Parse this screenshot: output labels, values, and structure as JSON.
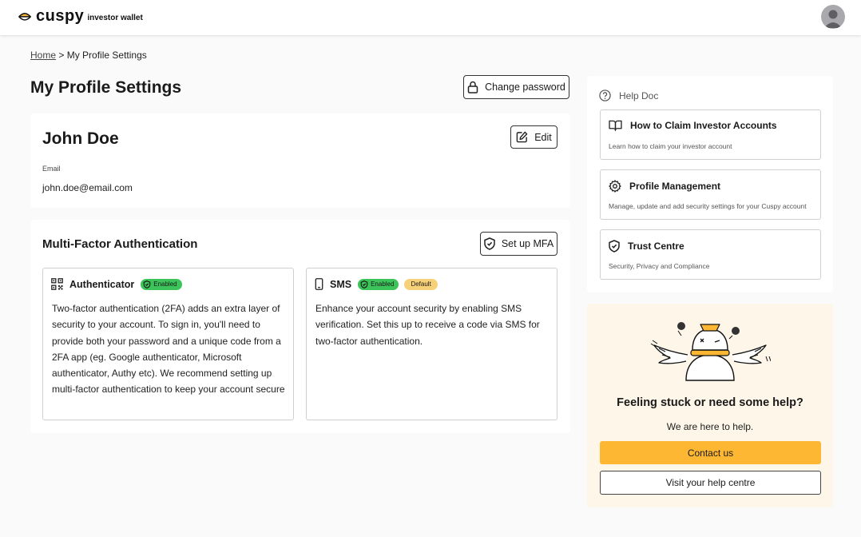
{
  "header": {
    "brand": "cuspy",
    "brand_sub": "investor wallet",
    "avatar_icon": "user-avatar-icon"
  },
  "breadcrumb": {
    "home": "Home",
    "separator": ">",
    "current": "My Profile Settings"
  },
  "page": {
    "title": "My Profile Settings",
    "change_password": "Change password"
  },
  "profile": {
    "name": "John Doe",
    "edit": "Edit",
    "email_label": "Email",
    "email_value": "john.doe@email.com"
  },
  "mfa": {
    "title": "Multi-Factor Authentication",
    "setup_button": "Set up MFA",
    "methods": [
      {
        "name": "Authenticator",
        "icon": "qr-code-icon",
        "badges": [
          "Enabled"
        ],
        "description": "Two-factor authentication (2FA) adds an extra layer of security to your account. To sign in, you'll need to provide both your password and a unique code from a 2FA app (eg. Google authenticator, Microsoft authenticator, Authy etc). We recommend setting up multi-factor authentication to keep your account secure"
      },
      {
        "name": "SMS",
        "icon": "phone-icon",
        "badges": [
          "Enabled",
          "Default"
        ],
        "description": "Enhance your account security by enabling SMS verification. Set this up to receive a code via SMS for two-factor authentication."
      }
    ]
  },
  "help": {
    "title": "Help Doc",
    "items": [
      {
        "title": "How to Claim Investor Accounts",
        "desc": "Learn how to claim your investor account",
        "icon": "book-icon"
      },
      {
        "title": "Profile Management",
        "desc": "Manage, update and add security settings for your Cuspy account",
        "icon": "gear-icon"
      },
      {
        "title": "Trust Centre",
        "desc": "Security, Privacy and Compliance",
        "icon": "shield-icon"
      }
    ]
  },
  "support": {
    "title": "Feeling stuck or need some help?",
    "subtitle": "We are here to help.",
    "contact": "Contact us",
    "visit": "Visit your help centre"
  },
  "colors": {
    "accent": "#fdb733",
    "enabled": "#3cc45a",
    "default": "#f7d07a",
    "support_bg": "#fdf6e9"
  }
}
